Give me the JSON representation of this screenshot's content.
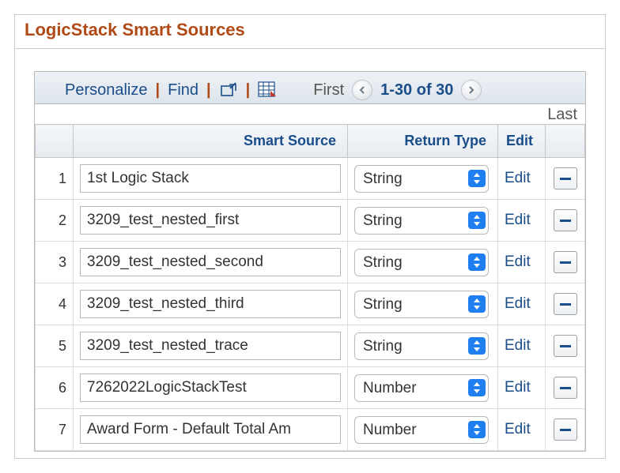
{
  "title": "LogicStack Smart Sources",
  "toolbar": {
    "personalize": "Personalize",
    "find": "Find",
    "first": "First",
    "range": "1-30 of 30",
    "last": "Last"
  },
  "columns": {
    "smart_source": "Smart Source",
    "return_type": "Return Type",
    "edit": "Edit"
  },
  "return_type_options": [
    "String",
    "Number"
  ],
  "edit_label": "Edit",
  "rows": [
    {
      "n": "1",
      "name": "1st Logic Stack",
      "rt": "String"
    },
    {
      "n": "2",
      "name": "3209_test_nested_first",
      "rt": "String"
    },
    {
      "n": "3",
      "name": "3209_test_nested_second",
      "rt": "String"
    },
    {
      "n": "4",
      "name": "3209_test_nested_third",
      "rt": "String"
    },
    {
      "n": "5",
      "name": "3209_test_nested_trace",
      "rt": "String"
    },
    {
      "n": "6",
      "name": "7262022LogicStackTest",
      "rt": "Number"
    },
    {
      "n": "7",
      "name": "Award Form - Default Total Am",
      "rt": "Number"
    }
  ]
}
